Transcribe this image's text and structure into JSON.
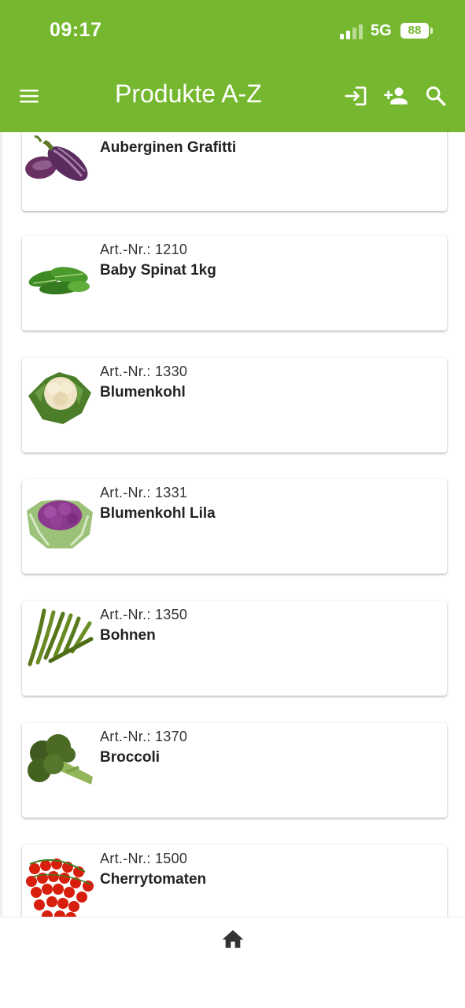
{
  "status_bar": {
    "time": "09:17",
    "network": "5G",
    "battery": "88"
  },
  "app_bar": {
    "menu_icon": "menu-icon",
    "title": "Produkte A-Z",
    "actions": [
      "login-icon",
      "add-person-icon",
      "search-icon"
    ]
  },
  "products": [
    {
      "artnr": "",
      "name": "Auberginen Grafitti",
      "image": "eggplant"
    },
    {
      "artnr": "Art.-Nr.: 1210",
      "name": "Baby Spinat 1kg",
      "image": "spinach"
    },
    {
      "artnr": "Art.-Nr.: 1330",
      "name": "Blumenkohl",
      "image": "cauliflower"
    },
    {
      "artnr": "Art.-Nr.: 1331",
      "name": "Blumenkohl Lila",
      "image": "purple-cauliflower"
    },
    {
      "artnr": "Art.-Nr.: 1350",
      "name": "Bohnen",
      "image": "green-beans"
    },
    {
      "artnr": "Art.-Nr.: 1370",
      "name": "Broccoli",
      "image": "broccoli"
    },
    {
      "artnr": "Art.-Nr.: 1500",
      "name": "Cherrytomaten",
      "image": "cherry-tomatoes"
    }
  ],
  "bottom_nav": {
    "icon": "home-icon"
  },
  "colors": {
    "primary": "#75b82f",
    "text": "#222222",
    "background": "#ffffff"
  }
}
